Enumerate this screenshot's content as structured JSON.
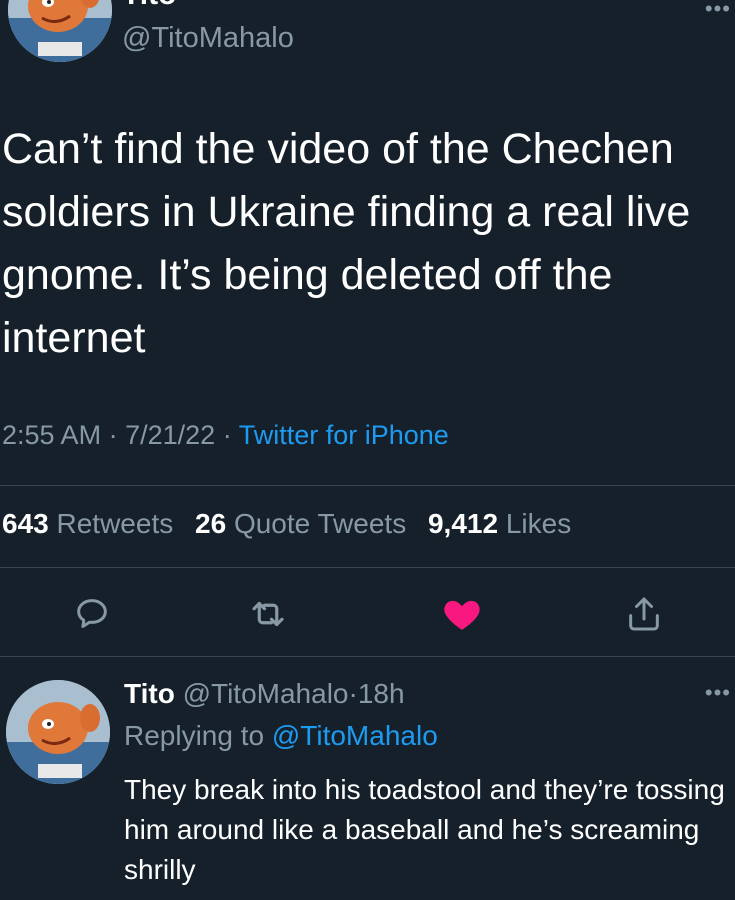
{
  "header": {
    "name": "Tito",
    "handle": "@TitoMahalo",
    "more_icon": "more-dots-icon"
  },
  "tweet": {
    "text": "Can’t find the video of the Chechen soldiers in Ukraine finding a real live gnome. It’s being deleted off the internet",
    "time": "2:55 AM",
    "date": "7/21/22",
    "source": "Twitter for iPhone",
    "sep": "·"
  },
  "stats": {
    "retweets_count": "643",
    "retweets_label": "Retweets",
    "quotes_count": "26",
    "quotes_label": "Quote Tweets",
    "likes_count": "9,412",
    "likes_label": "Likes"
  },
  "actions": {
    "reply_icon": "reply-icon",
    "retweet_icon": "retweet-icon",
    "like_icon": "heart-filled-icon",
    "share_icon": "share-icon",
    "like_color": "#f91880"
  },
  "reply": {
    "name": "Tito",
    "handle": "@TitoMahalo",
    "sep": "·",
    "age": "18h",
    "replying_label": "Replying to",
    "replying_to": "@TitoMahalo",
    "text": "They break into his toadstool and they’re tossing him around like a baseball and he’s screaming shrilly"
  },
  "colors": {
    "background": "#15202b",
    "secondary_text": "#8899a6",
    "link": "#1d9bf0",
    "divider": "#38444d"
  }
}
